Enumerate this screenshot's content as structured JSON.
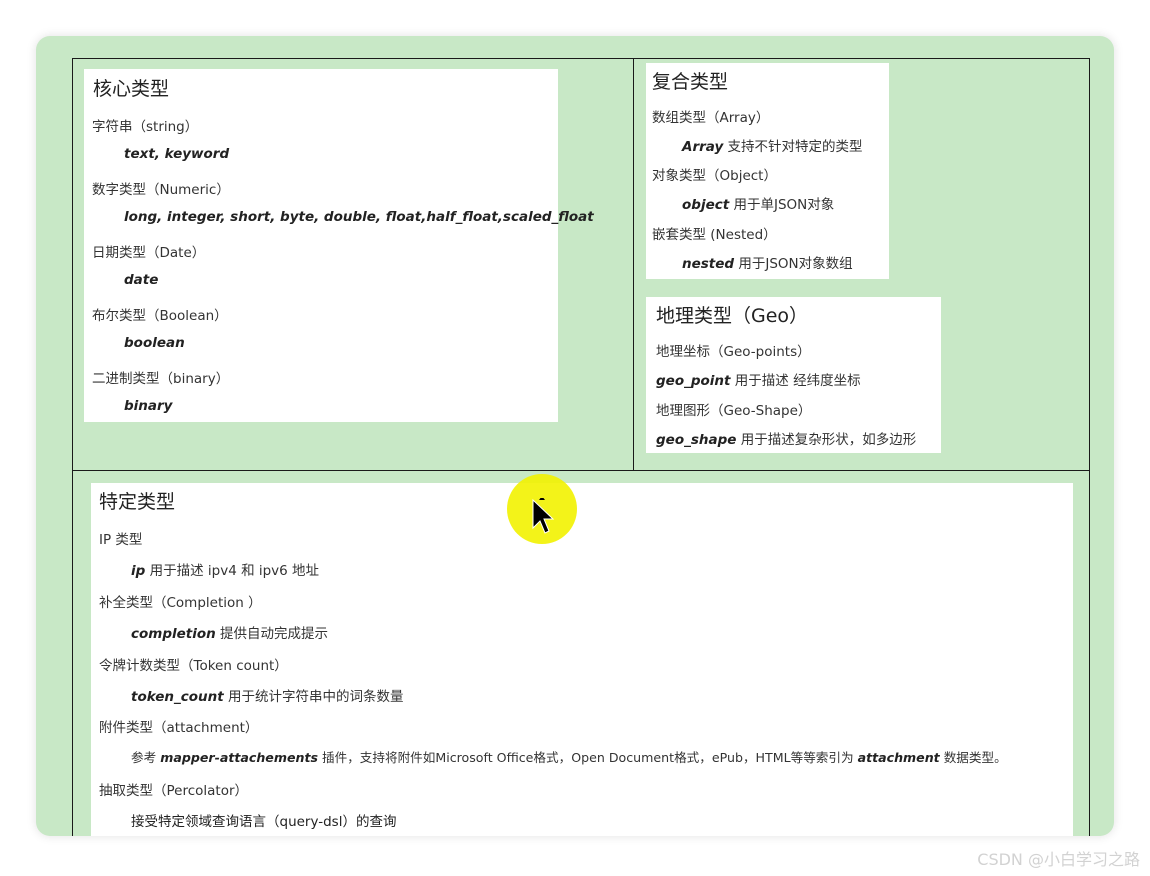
{
  "core": {
    "title": "核心类型",
    "string": {
      "label": "字符串（string）",
      "types": "text, keyword"
    },
    "numeric": {
      "label": "数字类型（Numeric）",
      "types": "long, integer, short, byte, double, float,half_float,scaled_float"
    },
    "date": {
      "label": "日期类型（Date）",
      "types": "date"
    },
    "boolean": {
      "label": "布尔类型（Boolean）",
      "types": "boolean"
    },
    "binary": {
      "label": "二进制类型（binary）",
      "types": "binary"
    }
  },
  "complex": {
    "title": "复合类型",
    "array": {
      "label": "数组类型（Array）",
      "kw": "Array",
      "desc": " 支持不针对特定的类型"
    },
    "object": {
      "label": "对象类型（Object）",
      "kw": "object",
      "desc": " 用于单JSON对象"
    },
    "nested": {
      "label": "嵌套类型 (Nested）",
      "kw": "nested",
      "desc": " 用于JSON对象数组"
    }
  },
  "geo": {
    "title": "地理类型（Geo）",
    "points_label": "地理坐标（Geo-points）",
    "point_kw": "geo_point",
    "point_desc": " 用于描述 经纬度坐标",
    "shape_label": "地理图形（Geo-Shape）",
    "shape_kw": "geo_shape",
    "shape_desc": " 用于描述复杂形状，如多边形"
  },
  "specific": {
    "title": "特定类型",
    "ip": {
      "label": "IP 类型",
      "kw": "ip",
      "desc": " 用于描述 ipv4 和 ipv6 地址"
    },
    "completion": {
      "label": "补全类型（Completion ）",
      "kw": "completion",
      "desc": " 提供自动完成提示"
    },
    "token": {
      "label": "令牌计数类型（Token count）",
      "kw": "token_count",
      "desc": " 用于统计字符串中的词条数量"
    },
    "attachment": {
      "label": "附件类型（attachment）",
      "pre": "参考 ",
      "kw": "mapper-attachements",
      "mid": " 插件，支持将附件如Microsoft Office格式，Open Document格式，ePub，HTML等等索引为 ",
      "kw2": "attachment",
      "post": " 数据类型。"
    },
    "percolator": {
      "label": "抽取类型（Percolator）",
      "desc": "接受特定领域查询语言（query-dsl）的查询"
    }
  },
  "watermark": "CSDN @小白学习之路"
}
